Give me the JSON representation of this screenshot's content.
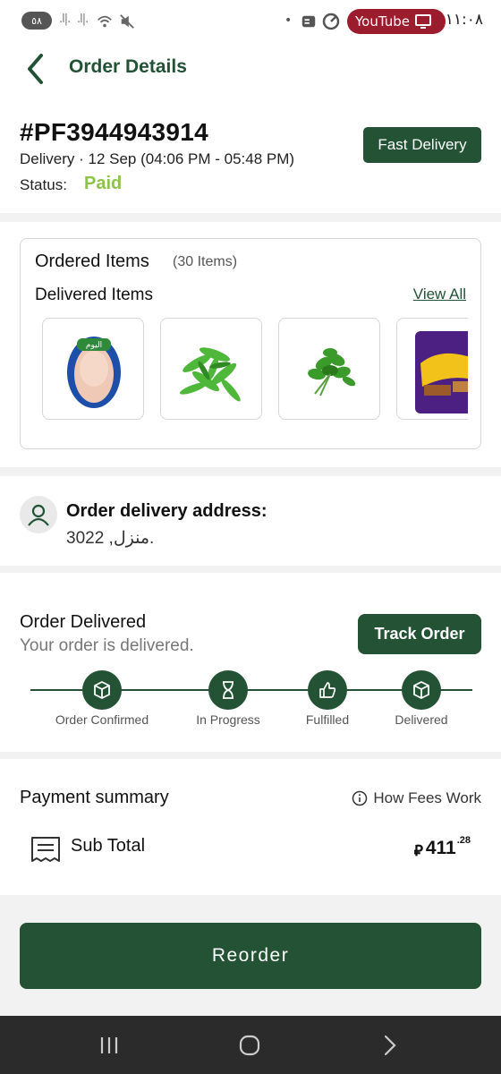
{
  "status_bar": {
    "badge": "٥٨",
    "time": "١١:٠٨",
    "youtube_label": "YouTube"
  },
  "header": {
    "title": "Order Details"
  },
  "order": {
    "id": "#PF3944943914",
    "delivery_line": "Delivery · 12 Sep (04:06 PM - 05:48 PM)",
    "status_label": "Status:",
    "status_value": "Paid",
    "badge": "Fast Delivery",
    "accent_color": "#235234",
    "paid_color": "#8cc34a"
  },
  "items": {
    "title": "Ordered Items",
    "count": "(30 Items)",
    "delivered_title": "Delivered Items",
    "view_all": "View All",
    "thumbnails": [
      "whole-chicken",
      "green-herbs",
      "mint-bunch",
      "cadbury-flake"
    ],
    "chicken_brand": "اليوم"
  },
  "address": {
    "title": "Order delivery address:",
    "value": "منزل, 3022."
  },
  "delivery": {
    "title": "Order Delivered",
    "subtitle": "Your order is delivered.",
    "track_button": "Track Order",
    "steps": [
      {
        "label": "Order Confirmed",
        "icon": "box-icon"
      },
      {
        "label": "In Progress",
        "icon": "hourglass-icon"
      },
      {
        "label": "Fulfilled",
        "icon": "thumbs-up-icon"
      },
      {
        "label": "Delivered",
        "icon": "box-icon"
      }
    ]
  },
  "payment": {
    "title": "Payment summary",
    "fees_link": "How Fees Work",
    "subtotal_label": "Sub Total",
    "currency": "⃁",
    "subtotal_int": "411",
    "subtotal_dec": ".28"
  },
  "actions": {
    "reorder": "Reorder"
  }
}
